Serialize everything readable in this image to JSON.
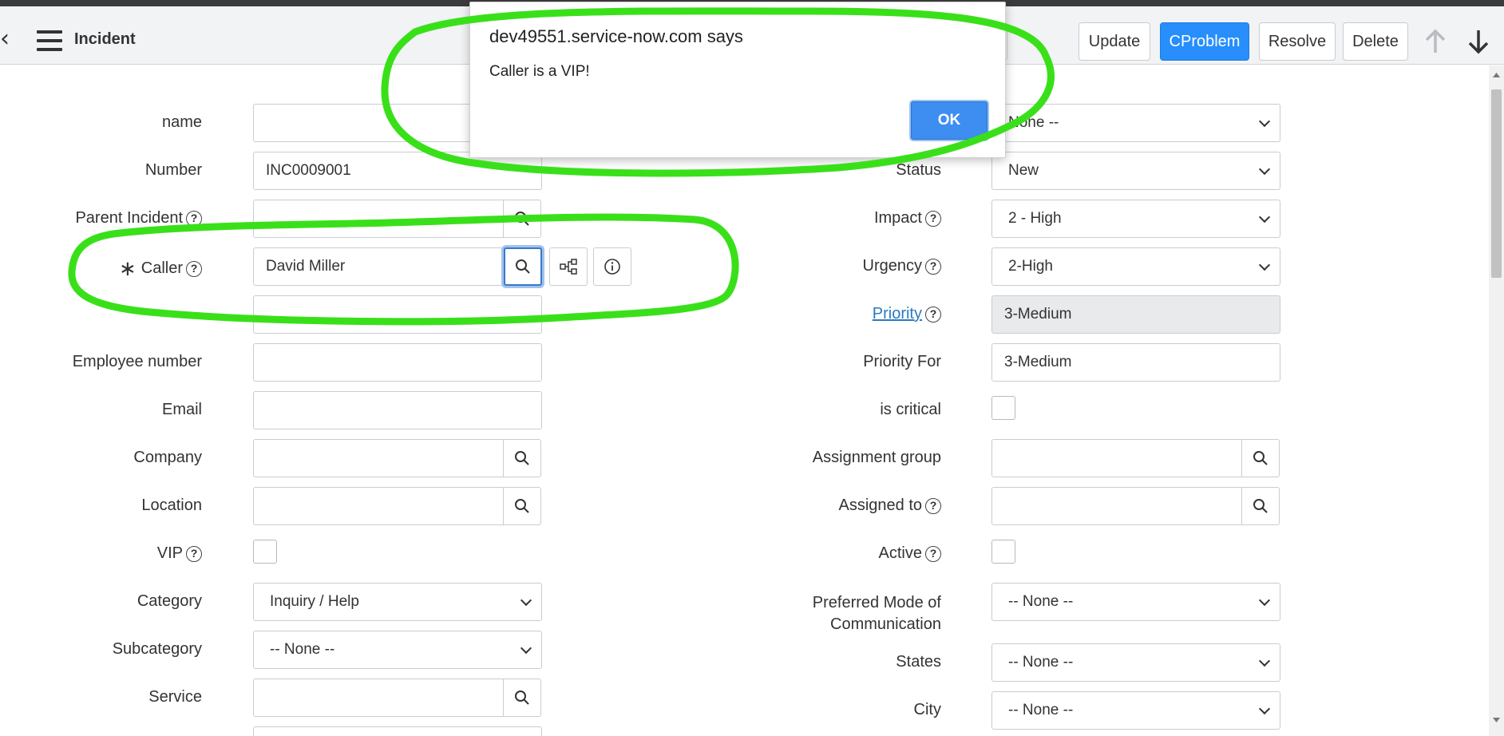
{
  "header": {
    "title": "Incident",
    "update_label": "Update",
    "cproblem_label": "CProblem",
    "resolve_label": "Resolve",
    "delete_label": "Delete"
  },
  "dialog": {
    "title": "dev49551.service-now.com says",
    "message": "Caller is a VIP!",
    "ok_label": "OK"
  },
  "left_fields": {
    "name": {
      "label": "name",
      "value": ""
    },
    "number": {
      "label": "Number",
      "value": "INC0009001"
    },
    "parent_incident": {
      "label": "Parent Incident",
      "value": ""
    },
    "caller": {
      "label": "Caller",
      "value": "David Miller"
    },
    "employee_number": {
      "label": "Employee number",
      "value": ""
    },
    "email": {
      "label": "Email",
      "value": ""
    },
    "company": {
      "label": "Company",
      "value": ""
    },
    "location": {
      "label": "Location",
      "value": ""
    },
    "vip": {
      "label": "VIP"
    },
    "category": {
      "label": "Category",
      "value": "Inquiry / Help"
    },
    "subcategory": {
      "label": "Subcategory",
      "value": "-- None --"
    },
    "service": {
      "label": "Service",
      "value": ""
    }
  },
  "right_fields": {
    "top_select": {
      "value": "None --"
    },
    "status": {
      "label": "Status",
      "value": "New"
    },
    "impact": {
      "label": "Impact",
      "value": "2 - High"
    },
    "urgency": {
      "label": "Urgency",
      "value": "2-High"
    },
    "priority": {
      "label": "Priority",
      "value": "3-Medium"
    },
    "priority_for": {
      "label": "Priority For",
      "value": "3-Medium"
    },
    "is_critical": {
      "label": "is critical"
    },
    "assignment_group": {
      "label": "Assignment group",
      "value": ""
    },
    "assigned_to": {
      "label": "Assigned to",
      "value": ""
    },
    "active": {
      "label": "Active"
    },
    "preferred_mode": {
      "label_line1": "Preferred Mode of",
      "label_line2": "Communication",
      "value": "-- None --"
    },
    "states": {
      "label": "States",
      "value": "-- None --"
    },
    "city": {
      "label": "City",
      "value": "-- None --"
    }
  },
  "icons": {
    "help": "?",
    "search": "search-icon",
    "hierarchy": "hierarchy-icon",
    "info": "info-icon"
  },
  "colors": {
    "primary_button": "#278efc",
    "annotation": "#39e01a",
    "link": "#2a7ac0"
  }
}
